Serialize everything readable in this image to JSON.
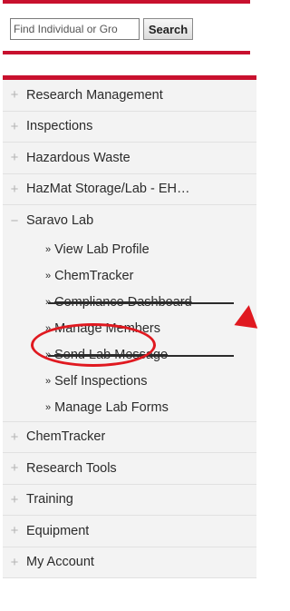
{
  "search": {
    "placeholder": "Find Individual or Gro",
    "button_label": "Search"
  },
  "nav": {
    "items": [
      {
        "toggle": "+",
        "label": "Research Management"
      },
      {
        "toggle": "+",
        "label": "Inspections"
      },
      {
        "toggle": "+",
        "label": "Hazardous Waste"
      },
      {
        "toggle": "+",
        "label": "HazMat Storage/Lab - EH…"
      },
      {
        "toggle": "−",
        "label": "Saravo Lab"
      },
      {
        "toggle": "+",
        "label": "ChemTracker"
      },
      {
        "toggle": "+",
        "label": "Research Tools"
      },
      {
        "toggle": "+",
        "label": "Training"
      },
      {
        "toggle": "+",
        "label": "Equipment"
      },
      {
        "toggle": "+",
        "label": "My Account"
      }
    ],
    "saravo_sub_items": [
      {
        "bullet": "»",
        "label": "View Lab Profile"
      },
      {
        "bullet": "»",
        "label": "ChemTracker"
      },
      {
        "bullet": "»",
        "label": "Compliance Dashboard"
      },
      {
        "bullet": "»",
        "label": "Manage Members"
      },
      {
        "bullet": "»",
        "label": "Send Lab Message"
      },
      {
        "bullet": "»",
        "label": "Self Inspections"
      },
      {
        "bullet": "»",
        "label": "Manage Lab Forms"
      }
    ]
  },
  "colors": {
    "accent_red": "#c8102e",
    "annotation_red": "#e01920"
  },
  "annotation": {
    "highlighted_item": "Manage Members",
    "shape": "ellipse-with-arrow"
  }
}
